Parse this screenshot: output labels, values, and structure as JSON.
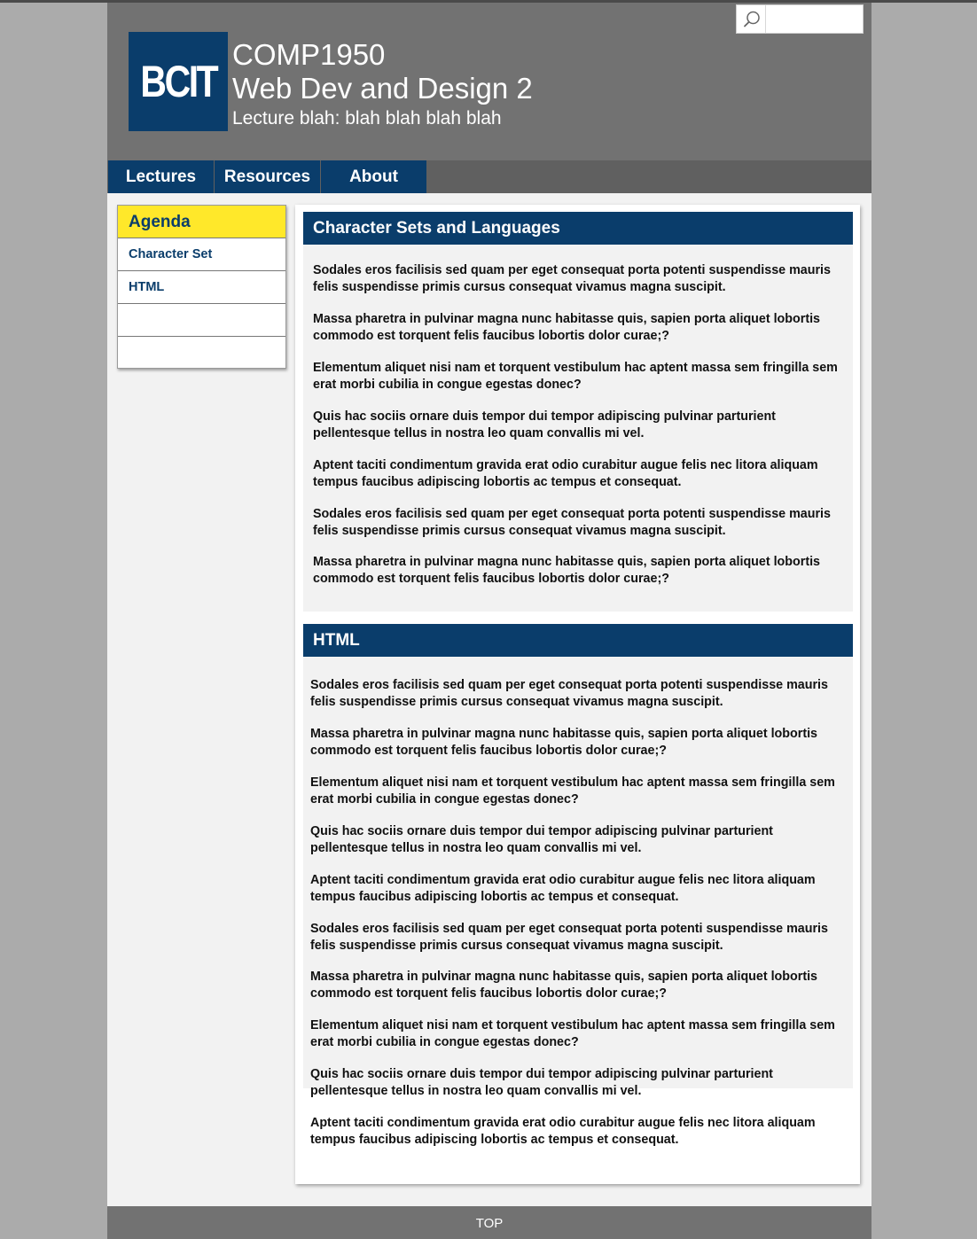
{
  "header": {
    "logo_text": "BCIT",
    "course_code": "COMP1950",
    "course_name": "Web Dev and Design 2",
    "lecture_line": "Lecture blah: blah blah blah blah",
    "search": {
      "placeholder": "",
      "value": ""
    }
  },
  "nav": {
    "items": [
      {
        "label": "Lectures"
      },
      {
        "label": "Resources"
      },
      {
        "label": "About"
      }
    ]
  },
  "agenda": {
    "title": "Agenda",
    "items": [
      {
        "label": "Character Set"
      },
      {
        "label": "HTML"
      },
      {
        "label": ""
      },
      {
        "label": ""
      }
    ]
  },
  "sections": [
    {
      "title": "Character Sets and Languages",
      "paragraphs": [
        "Sodales eros facilisis sed quam per eget consequat porta potenti suspendisse mauris felis suspendisse primis cursus consequat vivamus magna suscipit.",
        "Massa pharetra in pulvinar magna nunc habitasse quis, sapien porta aliquet lobortis commodo est torquent felis faucibus lobortis dolor curae;?",
        "Elementum aliquet nisi nam et torquent vestibulum hac aptent massa sem fringilla sem erat morbi cubilia in congue egestas donec?",
        "Quis hac sociis ornare duis tempor dui tempor adipiscing pulvinar parturient pellentesque tellus in nostra leo quam convallis mi vel.",
        "Aptent taciti condimentum gravida erat odio curabitur augue felis nec litora aliquam tempus faucibus adipiscing lobortis ac tempus et consequat.",
        "Sodales eros facilisis sed quam per eget consequat porta potenti suspendisse mauris felis suspendisse primis cursus consequat vivamus magna suscipit.",
        "Massa pharetra in pulvinar magna nunc habitasse quis, sapien porta aliquet lobortis commodo est torquent felis faucibus lobortis dolor curae;?"
      ]
    },
    {
      "title": "HTML",
      "paragraphs": [
        "Sodales eros facilisis sed quam per eget consequat porta potenti suspendisse mauris felis suspendisse primis cursus consequat vivamus magna suscipit.",
        "Massa pharetra in pulvinar magna nunc habitasse quis, sapien porta aliquet lobortis commodo est torquent felis faucibus lobortis dolor curae;?",
        "Elementum aliquet nisi nam et torquent vestibulum hac aptent massa sem fringilla sem erat morbi cubilia in congue egestas donec?",
        "Quis hac sociis ornare duis tempor dui tempor adipiscing pulvinar parturient pellentesque tellus in nostra leo quam convallis mi vel.",
        "Aptent taciti condimentum gravida erat odio curabitur augue felis nec litora aliquam tempus faucibus adipiscing lobortis ac tempus et consequat.",
        "Sodales eros facilisis sed quam per eget consequat porta potenti suspendisse mauris felis suspendisse primis cursus consequat vivamus magna suscipit.",
        "Massa pharetra in pulvinar magna nunc habitasse quis, sapien porta aliquet lobortis commodo est torquent felis faucibus lobortis dolor curae;?",
        "Elementum aliquet nisi nam et torquent vestibulum hac aptent massa sem fringilla sem erat morbi cubilia in congue egestas donec?",
        "Quis hac sociis ornare duis tempor dui tempor adipiscing pulvinar parturient pellentesque tellus in nostra leo quam convallis mi vel.",
        "Aptent taciti condimentum gravida erat odio curabitur augue felis nec litora aliquam tempus faucibus adipiscing lobortis ac tempus et consequat."
      ]
    }
  ],
  "footer": {
    "label": "TOP"
  },
  "colors": {
    "brand_blue": "#0a3d6b",
    "agenda_yellow": "#ffe82a",
    "header_gray": "#727272",
    "page_bg": "#ababab"
  }
}
